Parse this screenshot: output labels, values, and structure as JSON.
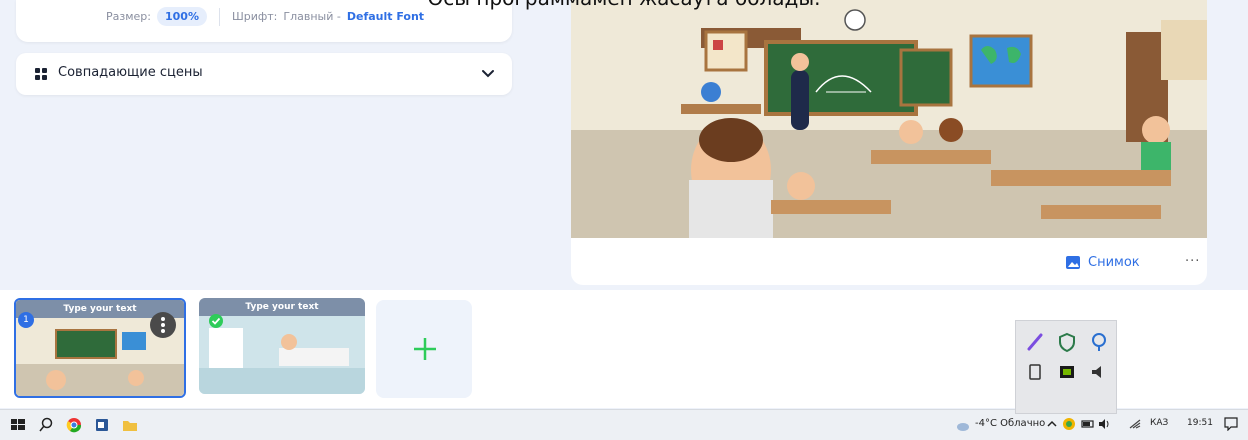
{
  "caption": "Осы программамен жасауға болады.",
  "props": {
    "size_label": "Размер:",
    "size_value": "100%",
    "font_label": "Шрифт:",
    "font_value": "Главный -",
    "font_name": "Default Font"
  },
  "matching_scenes": {
    "label": "Совпадающие сцены",
    "icon": "grid-icon"
  },
  "preview": {
    "snapshot_label": "Снимок",
    "more_label": "···"
  },
  "scenes": [
    {
      "number": "1",
      "label": "Type your text",
      "selected": true
    },
    {
      "label": "Type your text",
      "selected": false,
      "done": true
    }
  ],
  "add_scene": {
    "icon": "plus-icon"
  },
  "taskbar": {
    "weather": "-4°C Облачно",
    "language": "КАЗ",
    "time": "19:51"
  },
  "colors": {
    "accent": "#2f6fe4",
    "add": "#2ecc5a",
    "board": "#2f6b3a"
  }
}
